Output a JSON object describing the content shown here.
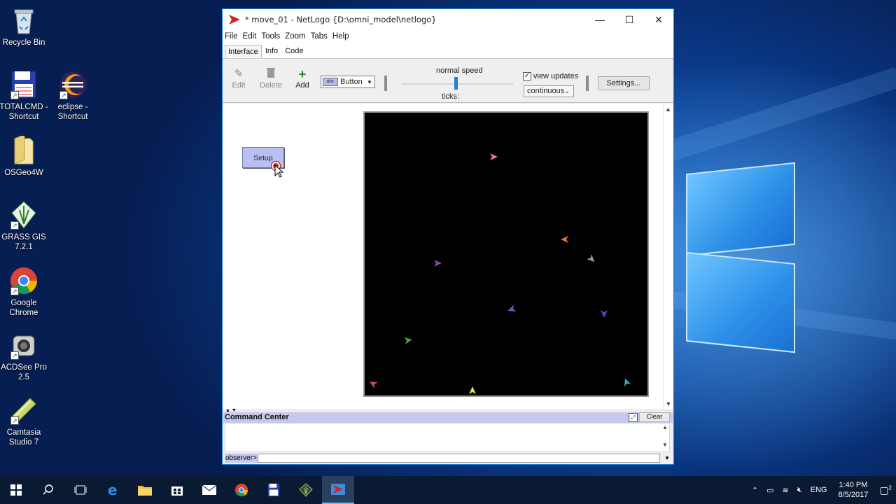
{
  "desktop": {
    "icons": [
      {
        "label": "Recycle Bin"
      },
      {
        "label": "TOTALCMD - Shortcut"
      },
      {
        "label": "eclipse - Shortcut"
      },
      {
        "label": "OSGeo4W"
      },
      {
        "label": "GRASS GIS 7.2.1"
      },
      {
        "label": "Google Chrome"
      },
      {
        "label": "ACDSee Pro 2.5"
      },
      {
        "label": "Camtasia Studio 7"
      }
    ]
  },
  "window": {
    "title": "* move_01 - NetLogo {D:\\omni_model\\netlogo}",
    "controls": {
      "minimize": "—",
      "maximize": "☐",
      "close": "✕"
    }
  },
  "menu": [
    "File",
    "Edit",
    "Tools",
    "Zoom",
    "Tabs",
    "Help"
  ],
  "tabs": [
    "Interface",
    "Info",
    "Code"
  ],
  "toolbar": {
    "edit": "Edit",
    "delete": "Delete",
    "add": "Add",
    "widget_type": "Button",
    "widget_chip": "abc",
    "speed_label": "normal speed",
    "speed_value": 0.5,
    "ticks_label": "ticks:",
    "view_updates_label": "view updates",
    "view_updates_checked": true,
    "update_mode": "continuous",
    "settings": "Settings..."
  },
  "interface": {
    "setup_button": "Setup",
    "turtles": [
      {
        "color": "#e87a8a",
        "heading": 90
      },
      {
        "color": "#e8742a",
        "heading": 270
      },
      {
        "color": "#9a9a9a",
        "heading": 135
      },
      {
        "color": "#8a4ab0",
        "heading": 90
      },
      {
        "color": "#7a5ab0",
        "heading": 250
      },
      {
        "color": "#4a4ac0",
        "heading": 180
      },
      {
        "color": "#4ea04e",
        "heading": 80
      },
      {
        "color": "#c04a7a",
        "heading": 300
      },
      {
        "color": "#e8e040",
        "heading": 0
      },
      {
        "color": "#3aa7b8",
        "heading": 340
      }
    ]
  },
  "command_center": {
    "title": "Command Center",
    "clear": "Clear",
    "prompt": "observer>"
  },
  "taskbar": {
    "lang": "ENG",
    "time": "1:40 PM",
    "date": "8/5/2017",
    "notifications": "2"
  }
}
